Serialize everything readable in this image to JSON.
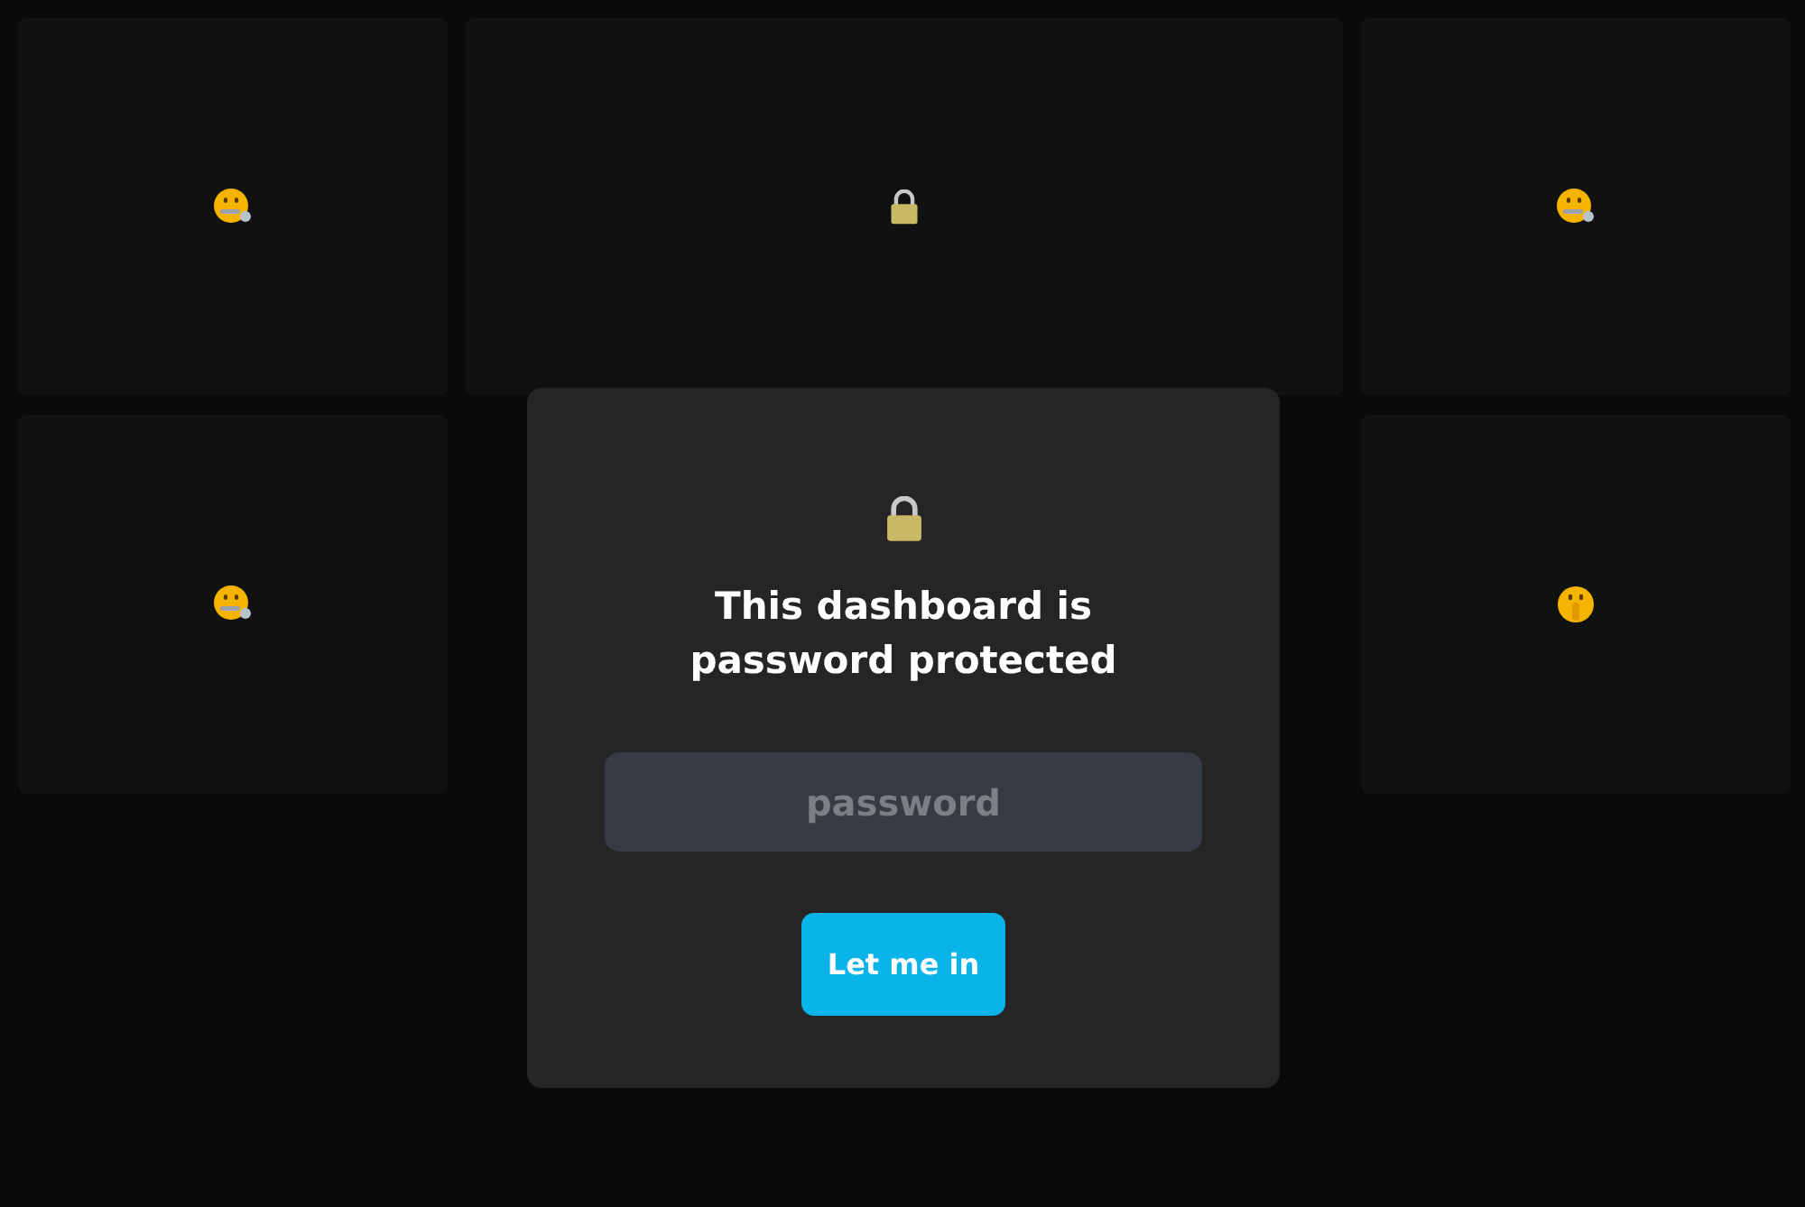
{
  "tiles": [
    {
      "kind": "zipper"
    },
    {
      "kind": "lock"
    },
    {
      "kind": "zipper"
    },
    {
      "kind": "zipper"
    },
    {
      "kind": "hush"
    }
  ],
  "dialog": {
    "title": "This dashboard is password protected",
    "password": {
      "placeholder": "password"
    },
    "button": "Let me in"
  }
}
